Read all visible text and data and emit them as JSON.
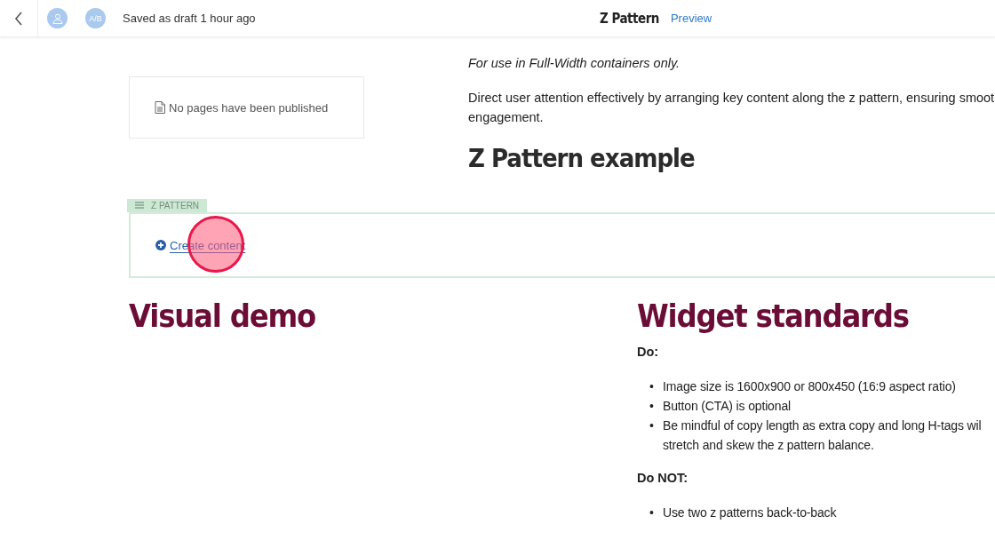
{
  "header": {
    "avatar_badge": "A/B",
    "status": "Saved as draft 1 hour ago",
    "title": "Z Pattern",
    "preview_link": "Preview"
  },
  "pages_panel": {
    "message": "No pages have been published"
  },
  "intro": {
    "note": "For use in Full-Width containers only.",
    "paragraph_lines": [
      "Direct user attention effectively by arranging key content along the z pattern, ensuring smoot",
      "engagement."
    ],
    "heading": "Z Pattern example"
  },
  "z_pattern_block": {
    "tag": "Z PATTERN",
    "create_link": "Create content"
  },
  "visual_demo": {
    "heading": "Visual demo"
  },
  "widget_standards": {
    "heading": "Widget standards",
    "sections": [
      {
        "label": "Do:",
        "items": [
          {
            "marker": "•",
            "lines": [
              "Image size is 1600x900 or 800x450 (16:9 aspect ratio)"
            ]
          },
          {
            "marker": "•",
            "lines": [
              "Button (CTA) is optional"
            ]
          },
          {
            "marker": "•",
            "lines": [
              "Be mindful of copy length as extra copy and long H-tags wil",
              "stretch and skew the z pattern balance."
            ]
          }
        ]
      },
      {
        "label": "Do NOT:",
        "items": [
          {
            "marker": "•",
            "lines": [
              "Use two z patterns back-to-back"
            ]
          }
        ]
      }
    ]
  }
}
